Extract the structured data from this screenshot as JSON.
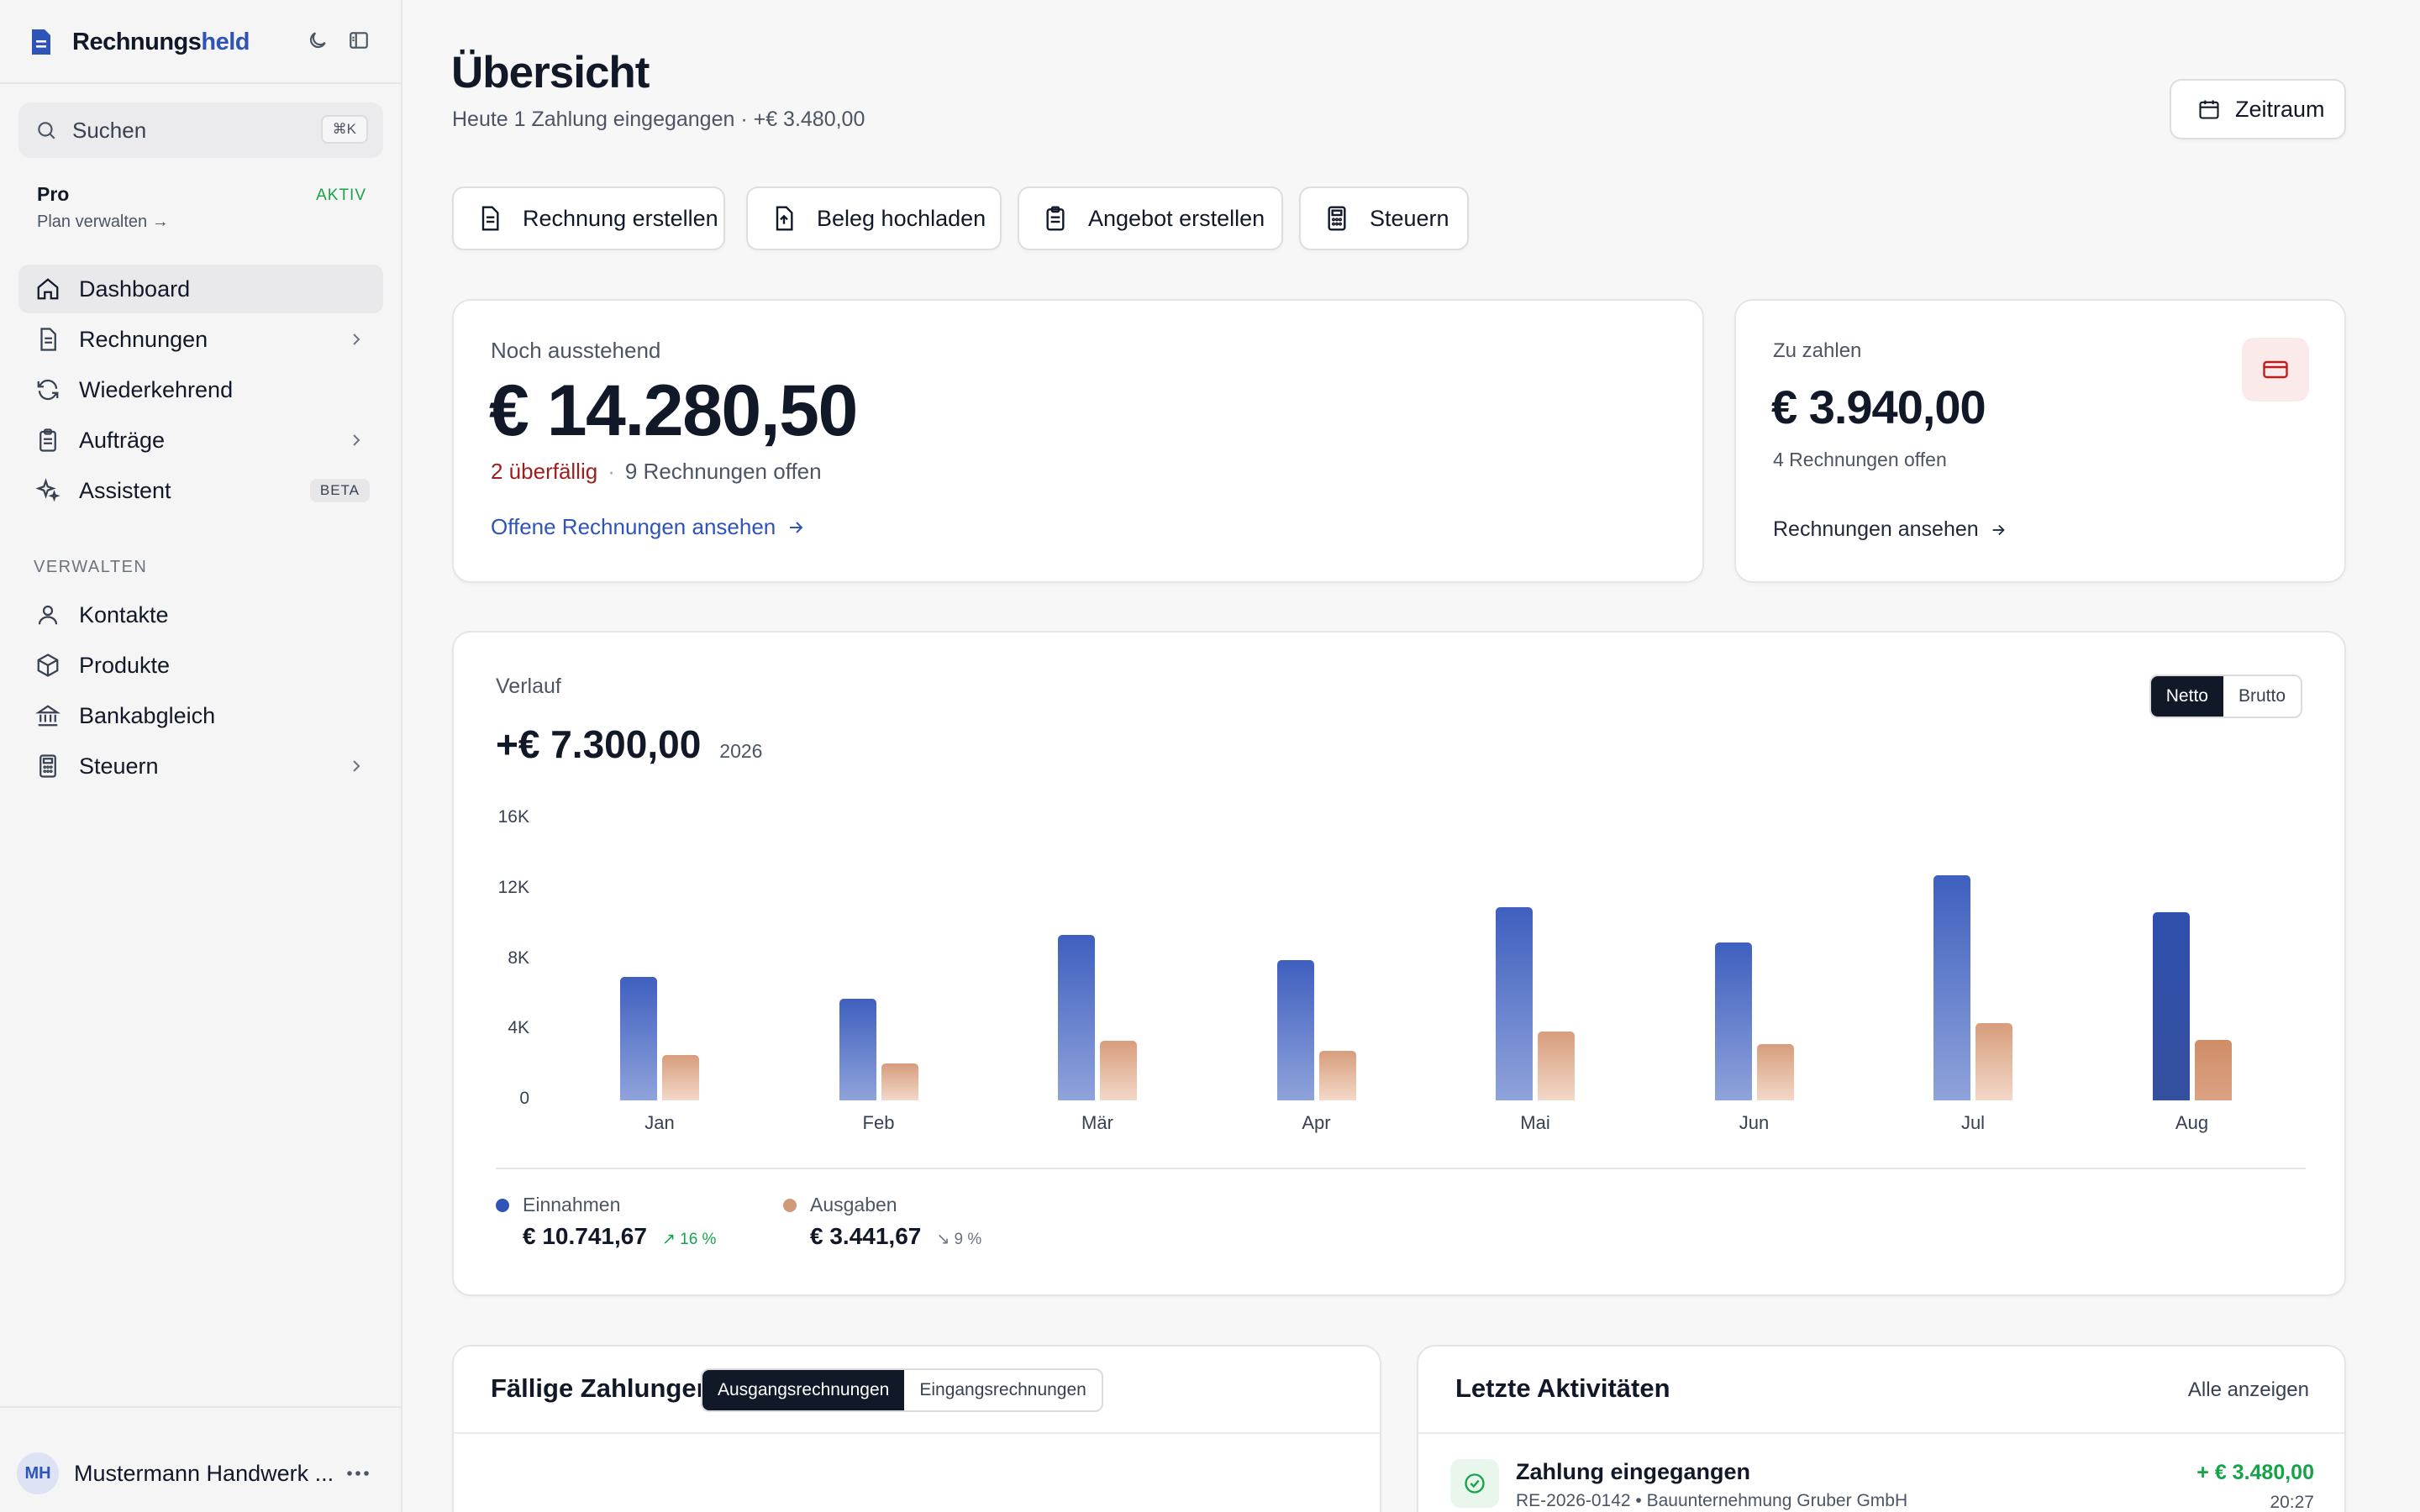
{
  "app": {
    "brand_main": "Rechnungs",
    "brand_accent": "held"
  },
  "sidebar": {
    "search_label": "Suchen",
    "search_shortcut": "⌘K",
    "plan": {
      "name": "Pro",
      "status": "AKTIV",
      "link": "Plan verwalten →"
    },
    "items": [
      {
        "label": "Dashboard",
        "icon": "home-icon"
      },
      {
        "label": "Rechnungen",
        "icon": "document-icon"
      },
      {
        "label": "Wiederkehrend",
        "icon": "refresh-icon"
      },
      {
        "label": "Aufträge",
        "icon": "clipboard-icon"
      },
      {
        "label": "Assistent",
        "icon": "sparkles-icon",
        "badge": "BETA"
      }
    ],
    "section_label": "VERWALTEN",
    "manage_items": [
      {
        "label": "Kontakte",
        "icon": "user-icon"
      },
      {
        "label": "Produkte",
        "icon": "box-icon"
      },
      {
        "label": "Bankabgleich",
        "icon": "bank-icon"
      },
      {
        "label": "Steuern",
        "icon": "calculator-icon"
      }
    ],
    "user": {
      "initials": "MH",
      "name": "Mustermann Handwerk ..."
    }
  },
  "header": {
    "title": "Übersicht",
    "subtitle": "Heute 1 Zahlung eingegangen · +€ 3.480,00",
    "period_button": "Zeitraum"
  },
  "quick_actions": [
    "Rechnung erstellen",
    "Beleg hochladen",
    "Angebot erstellen",
    "Steuern"
  ],
  "outstanding": {
    "label": "Noch ausstehend",
    "amount": "€ 14.280,50",
    "overdue": "2 überfällig",
    "separator": "·",
    "open": "9 Rechnungen offen",
    "link": "Offene Rechnungen ansehen"
  },
  "payable": {
    "label": "Zu zahlen",
    "amount": "€ 3.940,00",
    "open": "4 Rechnungen offen",
    "link": "Rechnungen ansehen"
  },
  "history": {
    "label": "Verlauf",
    "total": "+€ 7.300,00",
    "year": "2026",
    "toggle": {
      "on": "Netto",
      "off": "Brutto"
    },
    "legend": [
      {
        "name": "Einnahmen",
        "value": "€ 10.741,67",
        "change": "↗ 16 %",
        "color": "#2f54b8",
        "change_color": "#16a34a"
      },
      {
        "name": "Ausgaben",
        "value": "€ 3.441,67",
        "change": "↘ 9 %",
        "color": "#cf9a78",
        "change_color": "#6b7280"
      }
    ]
  },
  "chart_data": {
    "type": "bar",
    "categories": [
      "Jan",
      "Feb",
      "Mär",
      "Apr",
      "Mai",
      "Jun",
      "Jul",
      "Aug"
    ],
    "series": [
      {
        "name": "Einnahmen",
        "values": [
          7000,
          5800,
          9400,
          8000,
          11000,
          9000,
          12800,
          10700
        ]
      },
      {
        "name": "Ausgaben",
        "values": [
          2600,
          2100,
          3400,
          2800,
          3900,
          3200,
          4400,
          3450
        ]
      }
    ],
    "yticks": [
      "0",
      "4K",
      "8K",
      "12K",
      "16K"
    ],
    "ylim": [
      0,
      16000
    ]
  },
  "due_payments": {
    "title": "Fällige Zahlungen",
    "tabs": [
      "Ausgangsrechnungen",
      "Eingangsrechnungen"
    ]
  },
  "activities": {
    "title": "Letzte Aktivitäten",
    "link": "Alle anzeigen",
    "items": [
      {
        "title": "Zahlung eingegangen",
        "detail": "RE-2026-0142 • Bauunternehmung Gruber GmbH",
        "amount": "+ € 3.480,00",
        "time": "20:27"
      }
    ]
  }
}
